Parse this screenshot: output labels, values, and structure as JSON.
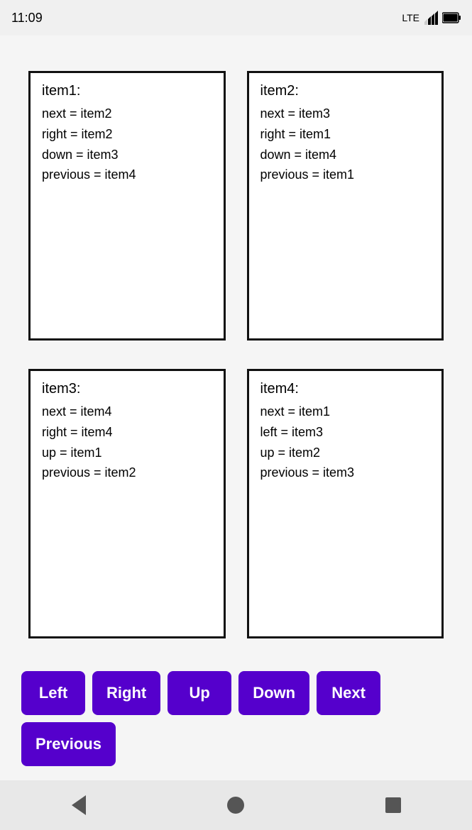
{
  "statusBar": {
    "time": "11:09",
    "signal": "LTE"
  },
  "items": [
    {
      "id": "item1",
      "title": "item1:",
      "properties": [
        "next = item2",
        "right = item2",
        "down = item3",
        "previous = item4"
      ]
    },
    {
      "id": "item2",
      "title": "item2:",
      "properties": [
        "next = item3",
        "right = item1",
        "down = item4",
        "previous = item1"
      ]
    },
    {
      "id": "item3",
      "title": "item3:",
      "properties": [
        "next = item4",
        "right = item4",
        "up = item1",
        "previous = item2"
      ]
    },
    {
      "id": "item4",
      "title": "item4:",
      "properties": [
        "next = item1",
        "left = item3",
        "up = item2",
        "previous = item3"
      ]
    }
  ],
  "buttons": {
    "left": "Left",
    "right": "Right",
    "up": "Up",
    "down": "Down",
    "next": "Next",
    "previous": "Previous"
  }
}
